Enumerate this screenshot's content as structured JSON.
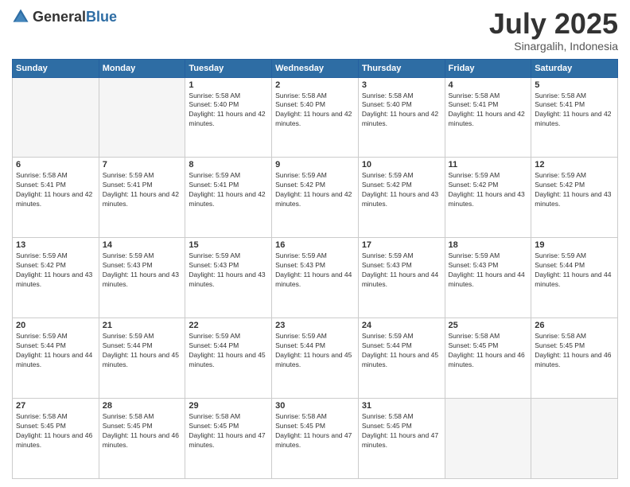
{
  "header": {
    "logo": {
      "general": "General",
      "blue": "Blue"
    },
    "title": "July 2025",
    "location": "Sinargalih, Indonesia"
  },
  "weekdays": [
    "Sunday",
    "Monday",
    "Tuesday",
    "Wednesday",
    "Thursday",
    "Friday",
    "Saturday"
  ],
  "weeks": [
    [
      {
        "day": "",
        "empty": true
      },
      {
        "day": "",
        "empty": true
      },
      {
        "day": "1",
        "sunrise": "5:58 AM",
        "sunset": "5:40 PM",
        "daylight": "11 hours and 42 minutes."
      },
      {
        "day": "2",
        "sunrise": "5:58 AM",
        "sunset": "5:40 PM",
        "daylight": "11 hours and 42 minutes."
      },
      {
        "day": "3",
        "sunrise": "5:58 AM",
        "sunset": "5:40 PM",
        "daylight": "11 hours and 42 minutes."
      },
      {
        "day": "4",
        "sunrise": "5:58 AM",
        "sunset": "5:41 PM",
        "daylight": "11 hours and 42 minutes."
      },
      {
        "day": "5",
        "sunrise": "5:58 AM",
        "sunset": "5:41 PM",
        "daylight": "11 hours and 42 minutes."
      }
    ],
    [
      {
        "day": "6",
        "sunrise": "5:58 AM",
        "sunset": "5:41 PM",
        "daylight": "11 hours and 42 minutes."
      },
      {
        "day": "7",
        "sunrise": "5:59 AM",
        "sunset": "5:41 PM",
        "daylight": "11 hours and 42 minutes."
      },
      {
        "day": "8",
        "sunrise": "5:59 AM",
        "sunset": "5:41 PM",
        "daylight": "11 hours and 42 minutes."
      },
      {
        "day": "9",
        "sunrise": "5:59 AM",
        "sunset": "5:42 PM",
        "daylight": "11 hours and 42 minutes."
      },
      {
        "day": "10",
        "sunrise": "5:59 AM",
        "sunset": "5:42 PM",
        "daylight": "11 hours and 43 minutes."
      },
      {
        "day": "11",
        "sunrise": "5:59 AM",
        "sunset": "5:42 PM",
        "daylight": "11 hours and 43 minutes."
      },
      {
        "day": "12",
        "sunrise": "5:59 AM",
        "sunset": "5:42 PM",
        "daylight": "11 hours and 43 minutes."
      }
    ],
    [
      {
        "day": "13",
        "sunrise": "5:59 AM",
        "sunset": "5:42 PM",
        "daylight": "11 hours and 43 minutes."
      },
      {
        "day": "14",
        "sunrise": "5:59 AM",
        "sunset": "5:43 PM",
        "daylight": "11 hours and 43 minutes."
      },
      {
        "day": "15",
        "sunrise": "5:59 AM",
        "sunset": "5:43 PM",
        "daylight": "11 hours and 43 minutes."
      },
      {
        "day": "16",
        "sunrise": "5:59 AM",
        "sunset": "5:43 PM",
        "daylight": "11 hours and 44 minutes."
      },
      {
        "day": "17",
        "sunrise": "5:59 AM",
        "sunset": "5:43 PM",
        "daylight": "11 hours and 44 minutes."
      },
      {
        "day": "18",
        "sunrise": "5:59 AM",
        "sunset": "5:43 PM",
        "daylight": "11 hours and 44 minutes."
      },
      {
        "day": "19",
        "sunrise": "5:59 AM",
        "sunset": "5:44 PM",
        "daylight": "11 hours and 44 minutes."
      }
    ],
    [
      {
        "day": "20",
        "sunrise": "5:59 AM",
        "sunset": "5:44 PM",
        "daylight": "11 hours and 44 minutes."
      },
      {
        "day": "21",
        "sunrise": "5:59 AM",
        "sunset": "5:44 PM",
        "daylight": "11 hours and 45 minutes."
      },
      {
        "day": "22",
        "sunrise": "5:59 AM",
        "sunset": "5:44 PM",
        "daylight": "11 hours and 45 minutes."
      },
      {
        "day": "23",
        "sunrise": "5:59 AM",
        "sunset": "5:44 PM",
        "daylight": "11 hours and 45 minutes."
      },
      {
        "day": "24",
        "sunrise": "5:59 AM",
        "sunset": "5:44 PM",
        "daylight": "11 hours and 45 minutes."
      },
      {
        "day": "25",
        "sunrise": "5:58 AM",
        "sunset": "5:45 PM",
        "daylight": "11 hours and 46 minutes."
      },
      {
        "day": "26",
        "sunrise": "5:58 AM",
        "sunset": "5:45 PM",
        "daylight": "11 hours and 46 minutes."
      }
    ],
    [
      {
        "day": "27",
        "sunrise": "5:58 AM",
        "sunset": "5:45 PM",
        "daylight": "11 hours and 46 minutes."
      },
      {
        "day": "28",
        "sunrise": "5:58 AM",
        "sunset": "5:45 PM",
        "daylight": "11 hours and 46 minutes."
      },
      {
        "day": "29",
        "sunrise": "5:58 AM",
        "sunset": "5:45 PM",
        "daylight": "11 hours and 47 minutes."
      },
      {
        "day": "30",
        "sunrise": "5:58 AM",
        "sunset": "5:45 PM",
        "daylight": "11 hours and 47 minutes."
      },
      {
        "day": "31",
        "sunrise": "5:58 AM",
        "sunset": "5:45 PM",
        "daylight": "11 hours and 47 minutes."
      },
      {
        "day": "",
        "empty": true
      },
      {
        "day": "",
        "empty": true
      }
    ]
  ],
  "labels": {
    "sunrise": "Sunrise:",
    "sunset": "Sunset:",
    "daylight": "Daylight:"
  }
}
